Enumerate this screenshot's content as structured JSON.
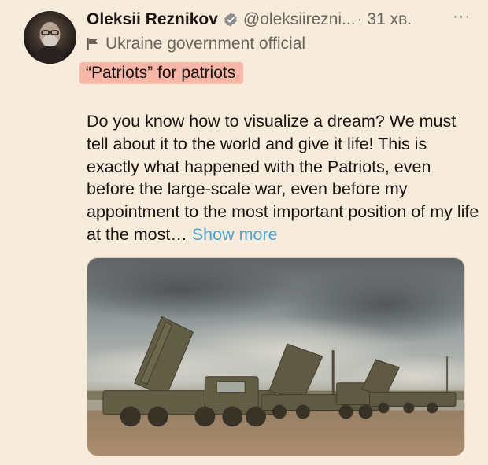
{
  "author": {
    "name": "Oleksii Reznikov",
    "handle": "@oleksiirezni...",
    "time": "· 31 хв.",
    "official_label": "Ukraine government official",
    "verified_color": "#8e8e8e"
  },
  "post": {
    "title": "“Patriots” for patriots",
    "text": "Do you know how to visualize a dream? We must tell about it to the world and give it life! This is exactly what happened with the Patriots, even before the large-scale war, even before my appointment to the most important position of my life at the most…",
    "show_more": "Show more"
  },
  "ui": {
    "more_glyph": "···",
    "highlight_color": "#f6b7a8",
    "link_color": "#4ca3d6"
  },
  "icons": {
    "verified": "verified-badge-icon",
    "flag": "flag-icon",
    "more": "more-options-icon"
  }
}
